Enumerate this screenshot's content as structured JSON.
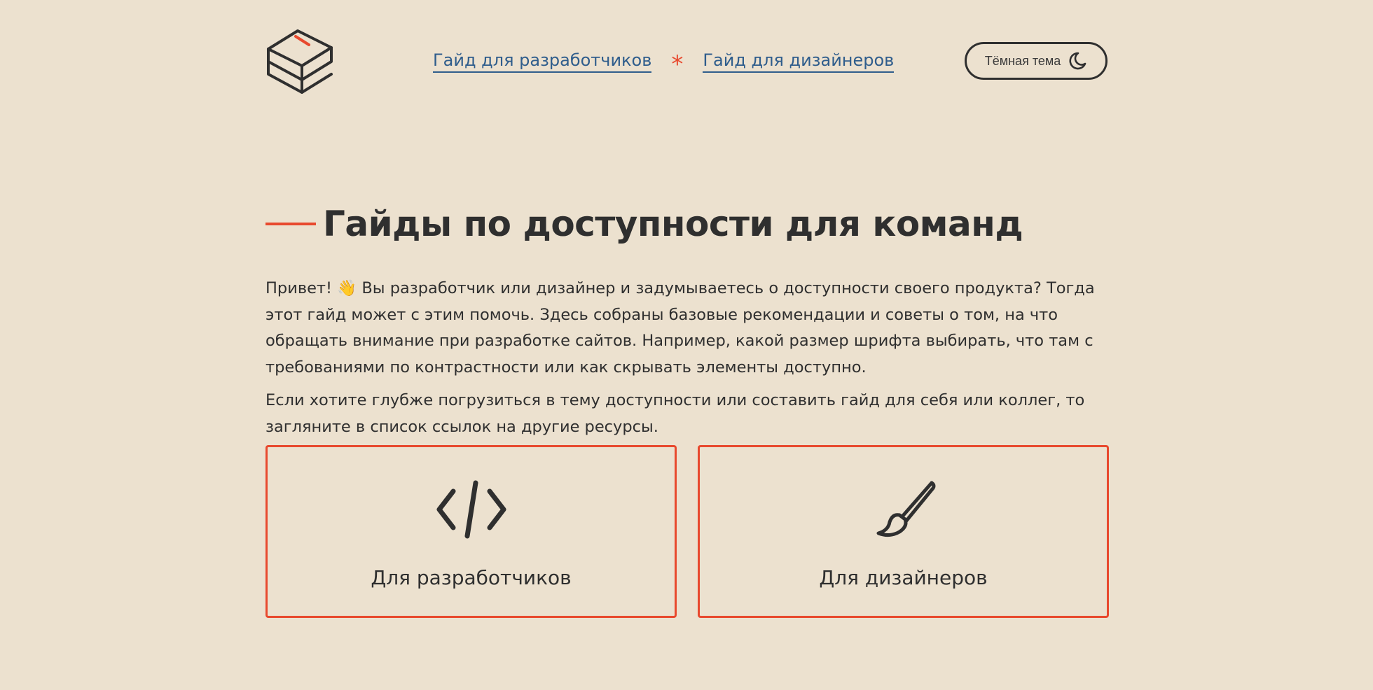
{
  "header": {
    "logo_icon": "book-stack-icon",
    "nav": {
      "developers_link": "Гайд для разработчиков",
      "separator": "*",
      "designers_link": "Гайд для дизайнеров"
    },
    "theme_button": {
      "label": "Тёмная тема",
      "icon": "moon-icon"
    }
  },
  "main": {
    "title": "Гайды по доступности для команд",
    "intro_paragraphs": [
      "Привет! 👋 Вы разработчик или дизайнер и задумываетесь о доступности своего продукта? Тогда этот гайд может с этим помочь. Здесь собраны базовые рекомендации и советы о том, на что обращать внимание при разработке сайтов. Например, какой размер шрифта выбирать, что там с требованиями по контрастности или как скрывать элементы доступно.",
      "Если хотите глубже погрузиться в тему доступности или составить гайд для себя или коллег, то загляните в список ссылок на другие ресурсы."
    ],
    "cards": [
      {
        "label": "Для разработчиков",
        "icon": "code-icon"
      },
      {
        "label": "Для дизайнеров",
        "icon": "brush-icon"
      }
    ]
  },
  "colors": {
    "background": "#ece1cf",
    "accent": "#e8492e",
    "link": "#2f5d8c",
    "text": "#2f2f2f"
  }
}
